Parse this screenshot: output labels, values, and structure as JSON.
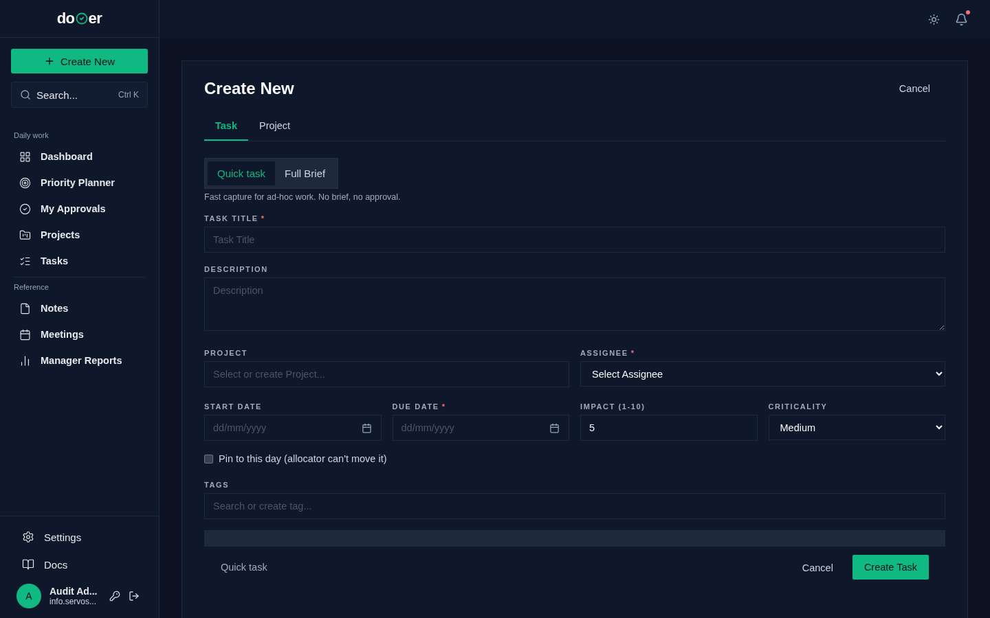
{
  "brand": {
    "before": "do",
    "after": "er"
  },
  "sidebar": {
    "create_button": "Create New",
    "search": {
      "label": "Search...",
      "shortcut": "Ctrl K"
    },
    "sections": [
      {
        "title": "Daily work",
        "items": [
          {
            "label": "Dashboard"
          },
          {
            "label": "Priority Planner"
          },
          {
            "label": "My Approvals"
          },
          {
            "label": "Projects"
          },
          {
            "label": "Tasks"
          }
        ]
      },
      {
        "title": "Reference",
        "items": [
          {
            "label": "Notes"
          },
          {
            "label": "Meetings"
          },
          {
            "label": "Manager Reports"
          }
        ]
      }
    ],
    "footer_items": [
      {
        "label": "Settings"
      },
      {
        "label": "Docs"
      }
    ],
    "user": {
      "initial": "A",
      "name": "Audit Ad...",
      "email": "info.servos..."
    }
  },
  "topbar": {
    "has_notification": true
  },
  "form": {
    "title": "Create New",
    "cancel": "Cancel",
    "tabs": [
      {
        "label": "Task",
        "selected": true
      },
      {
        "label": "Project",
        "selected": false
      }
    ],
    "modes": [
      {
        "label": "Quick task",
        "selected": true
      },
      {
        "label": "Full Brief",
        "selected": false
      }
    ],
    "mode_hint": "Fast capture for ad-hoc work. No brief, no approval.",
    "task_title": {
      "label": "TASK TITLE",
      "required_mark": "*",
      "placeholder": "Task Title"
    },
    "description": {
      "label": "DESCRIPTION",
      "placeholder": "Description"
    },
    "project": {
      "label": "PROJECT",
      "placeholder": "Select or create Project..."
    },
    "assignee": {
      "label": "ASSIGNEE",
      "required_mark": "*",
      "value": "Select Assignee"
    },
    "start_date": {
      "label": "START DATE",
      "placeholder": "dd/mm/yyyy"
    },
    "due_date": {
      "label": "DUE DATE",
      "required_mark": "*",
      "placeholder": "dd/mm/yyyy"
    },
    "impact": {
      "label": "IMPACT (1-10)",
      "value": "5"
    },
    "criticality": {
      "label": "CRITICALITY",
      "value": "Medium"
    },
    "pin": {
      "label": "Pin to this day (allocator can't move it)",
      "checked": false
    },
    "tags": {
      "label": "TAGS",
      "placeholder": "Search or create tag..."
    },
    "footer": {
      "mode_label": "Quick task",
      "cancel": "Cancel",
      "submit": "Create Task"
    }
  }
}
